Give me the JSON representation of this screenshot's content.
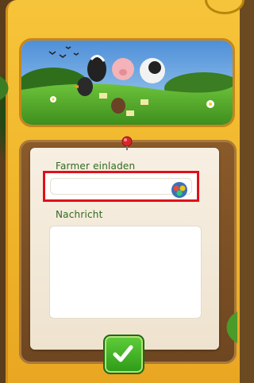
{
  "dialog": {
    "invite_label": "Farmer einladen",
    "invite_value": "",
    "message_label": "Nachricht",
    "message_value": ""
  },
  "icons": {
    "pin": "pushpin-icon",
    "friend": "friend-picker-icon",
    "confirm": "checkmark-icon"
  },
  "colors": {
    "frame": "#f0b52a",
    "label_text": "#2f6b1f",
    "highlight": "#e0101a",
    "confirm_button": "#3aa81e"
  }
}
